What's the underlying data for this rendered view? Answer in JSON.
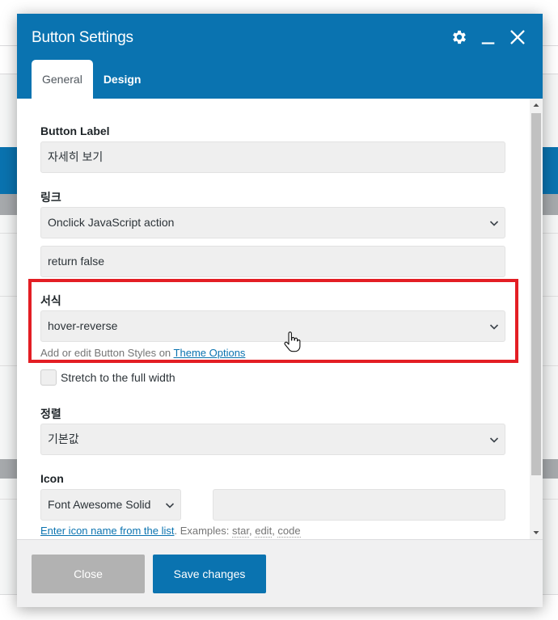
{
  "dialog": {
    "title": "Button Settings",
    "header_icons": [
      "gear-icon",
      "minimize-icon",
      "close-icon"
    ],
    "tabs": [
      {
        "label": "General",
        "active": true
      },
      {
        "label": "Design",
        "active": false
      }
    ]
  },
  "fields": {
    "button_label": {
      "label": "Button Label",
      "value": "자세히 보기"
    },
    "link": {
      "label": "링크",
      "selected": "Onclick JavaScript action",
      "value": "return false"
    },
    "style": {
      "label": "서식",
      "selected": "hover-reverse",
      "help_prefix": "Add or edit Button Styles on",
      "help_link": "Theme Options"
    },
    "full_width": {
      "label": "Stretch to the full width",
      "checked": false
    },
    "align": {
      "label": "정렬",
      "selected": "기본값"
    },
    "icon": {
      "label": "Icon",
      "selected": "Font Awesome Solid",
      "value": "",
      "help_link": "Enter icon name from the list",
      "help_examples_prefix": ". Examples:",
      "examples": [
        "star",
        "edit",
        "code"
      ]
    }
  },
  "footer": {
    "close_label": "Close",
    "save_label": "Save changes"
  },
  "colors": {
    "primary": "#0a73b0",
    "highlight": "#e31e24",
    "close_button": "#b2b2b2"
  }
}
